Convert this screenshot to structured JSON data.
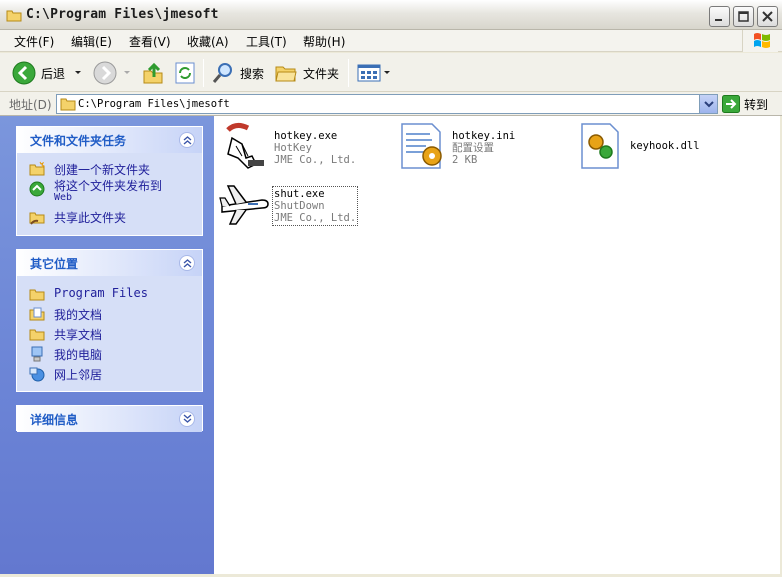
{
  "window": {
    "title": "C:\\Program Files\\jmesoft",
    "title_icon": "folder-icon"
  },
  "menubar": {
    "items": [
      "文件(F)",
      "编辑(E)",
      "查看(V)",
      "收藏(A)",
      "工具(T)",
      "帮助(H)"
    ]
  },
  "toolbar": {
    "back_label": "后退",
    "search_label": "搜索",
    "folders_label": "文件夹"
  },
  "address": {
    "label": "地址(D)",
    "value": "C:\\Program Files\\jmesoft",
    "go_label": "转到"
  },
  "left_pane": {
    "tasks": {
      "title": "文件和文件夹任务",
      "items": [
        {
          "label": "创建一个新文件夹",
          "icon": "new-folder-icon"
        },
        {
          "label": "将这个文件夹发布到",
          "label2": "Web",
          "icon": "publish-web-icon"
        },
        {
          "label": "共享此文件夹",
          "icon": "share-folder-icon"
        }
      ]
    },
    "places": {
      "title": "其它位置",
      "items": [
        {
          "label": "Program Files",
          "icon": "folder-icon"
        },
        {
          "label": "我的文档",
          "icon": "my-documents-icon"
        },
        {
          "label": "共享文档",
          "icon": "folder-icon"
        },
        {
          "label": "我的电脑",
          "icon": "my-computer-icon"
        },
        {
          "label": "网上邻居",
          "icon": "network-icon"
        }
      ]
    },
    "details": {
      "title": "详细信息"
    }
  },
  "files": [
    {
      "name": "hotkey.exe",
      "line2": "HotKey",
      "line3": "JME Co., Ltd.",
      "icon": "hotkey-app-icon"
    },
    {
      "name": "hotkey.ini",
      "line2": "配置设置",
      "line3": "2 KB",
      "icon": "config-file-icon"
    },
    {
      "name": "keyhook.dll",
      "line2": "",
      "line3": "",
      "icon": "dll-file-icon"
    },
    {
      "name": "shut.exe",
      "line2": "ShutDown",
      "line3": "JME Co., Ltd.",
      "icon": "airplane-app-icon"
    }
  ],
  "colors": {
    "task_pane_bg": "#6b84d6",
    "panel_title": "#215dc6",
    "link_text": "#21219b"
  }
}
